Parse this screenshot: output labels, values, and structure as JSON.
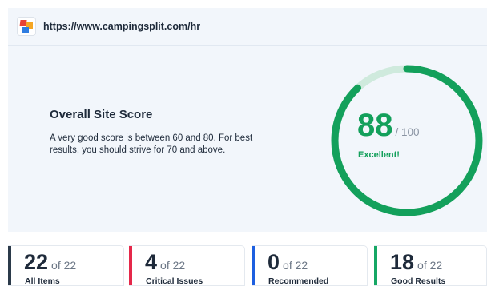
{
  "header": {
    "url": "https://www.campingsplit.com/hr",
    "logo_icon": "site-favicon-icon"
  },
  "overview": {
    "title": "Overall Site Score",
    "description": "A very good score is between 60 and 80. For best results, you should strive for 70 and above.",
    "score": "88",
    "score_max": "/ 100",
    "score_value": 88,
    "score_total": 100,
    "rating": "Excellent!",
    "colors": {
      "gauge_fill": "#13a05b",
      "gauge_track": "#cfeadd"
    }
  },
  "stats": [
    {
      "count": "22",
      "of": "of 22",
      "label": "All Items",
      "color": "#2b3a4a"
    },
    {
      "count": "4",
      "of": "of 22",
      "label": "Critical Issues",
      "color": "#e5284a"
    },
    {
      "count": "0",
      "of": "of 22",
      "label": "Recommended",
      "color": "#1d5fe0"
    },
    {
      "count": "18",
      "of": "of 22",
      "label": "Good Results",
      "color": "#16a765"
    }
  ]
}
